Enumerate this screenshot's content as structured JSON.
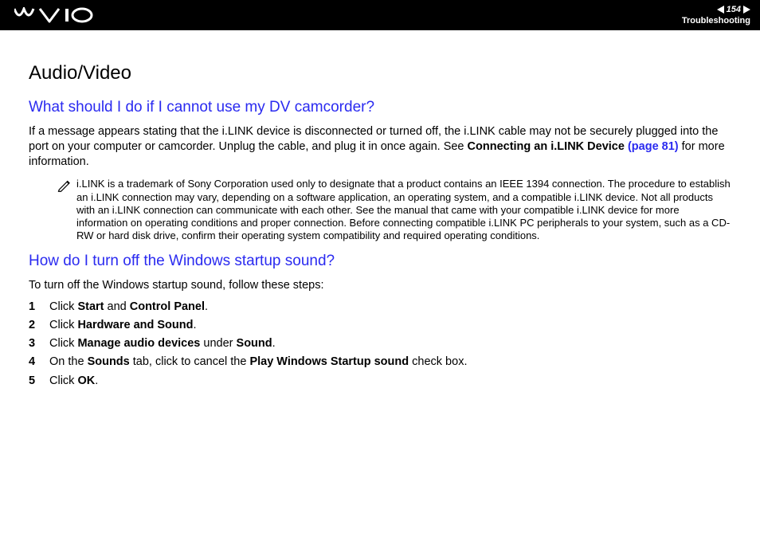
{
  "header": {
    "page_number": "154",
    "breadcrumb": "Troubleshooting"
  },
  "content": {
    "h1": "Audio/Video",
    "q1": {
      "heading": "What should I do if I cannot use my DV camcorder?",
      "para_pre": "If a message appears stating that the i.LINK device is disconnected or turned off, the i.LINK cable may not be securely plugged into the port on your computer or camcorder. Unplug the cable, and plug it in once again. See ",
      "xref_label": "Connecting an i.LINK Device",
      "xref_page": " (page 81)",
      "para_post": " for more information.",
      "note": "i.LINK is a trademark of Sony Corporation used only to designate that a product contains an IEEE 1394 connection. The procedure to establish an i.LINK connection may vary, depending on a software application, an operating system, and a compatible i.LINK device. Not all products with an i.LINK connection can communicate with each other. See the manual that came with your compatible i.LINK device for more information on operating conditions and proper connection. Before connecting compatible i.LINK PC peripherals to your system, such as a CD-RW or hard disk drive, confirm their operating system compatibility and required operating conditions."
    },
    "q2": {
      "heading": "How do I turn off the Windows startup sound?",
      "intro": "To turn off the Windows startup sound, follow these steps:",
      "steps": {
        "s1a": "Click ",
        "s1b": "Start",
        "s1c": " and ",
        "s1d": "Control Panel",
        "s1e": ".",
        "s2a": "Click ",
        "s2b": "Hardware and Sound",
        "s2c": ".",
        "s3a": "Click ",
        "s3b": "Manage audio devices",
        "s3c": " under ",
        "s3d": "Sound",
        "s3e": ".",
        "s4a": "On the ",
        "s4b": "Sounds",
        "s4c": " tab, click to cancel the ",
        "s4d": "Play Windows Startup sound",
        "s4e": " check box.",
        "s5a": "Click ",
        "s5b": "OK",
        "s5c": "."
      }
    }
  }
}
